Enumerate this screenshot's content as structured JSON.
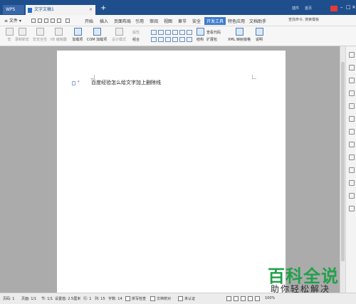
{
  "titlebar": {
    "app_tab": "WPS",
    "doc_tab": "文字文稿1",
    "doc_close": "×",
    "new_tab": "+",
    "right_text_1": "插件",
    "right_text_2": "首页",
    "min": "–",
    "max": "□",
    "close": "×"
  },
  "menubar": {
    "file": "≡ 文件 ▾",
    "tabs": [
      "开始",
      "插入",
      "页面布局",
      "引用",
      "审阅",
      "视图",
      "章节",
      "安全",
      "开发工具",
      "特色应用",
      "文档助手"
    ],
    "active_tab": "开发工具",
    "search": "查找命令, 搜索模板"
  },
  "toolbar": {
    "items": [
      "宏",
      "录制新宏",
      "宏安全性",
      "VB 编辑器",
      "加载项",
      "COM 加载项",
      "设计模式",
      "属性",
      "组合",
      "查看代码",
      "结构",
      "扩展包",
      "XML 映射窗格",
      "说明"
    ],
    "group_label": "加载项"
  },
  "document": {
    "text": "百度经验怎么给文字加上删除线"
  },
  "watermark": {
    "title": "百科全说",
    "subtitle": "助你轻松解决"
  },
  "statusbar": {
    "page_num": "页码: 1",
    "pages": "页面: 1/1",
    "section": "节: 1/1",
    "setting": "设置值: 2.5厘米",
    "row": "行: 1",
    "col": "列: 15",
    "chars": "字数: 14",
    "spellcheck": "拼写检查",
    "doc_check": "文档校对",
    "cert": "未认证",
    "zoom": "100%"
  }
}
